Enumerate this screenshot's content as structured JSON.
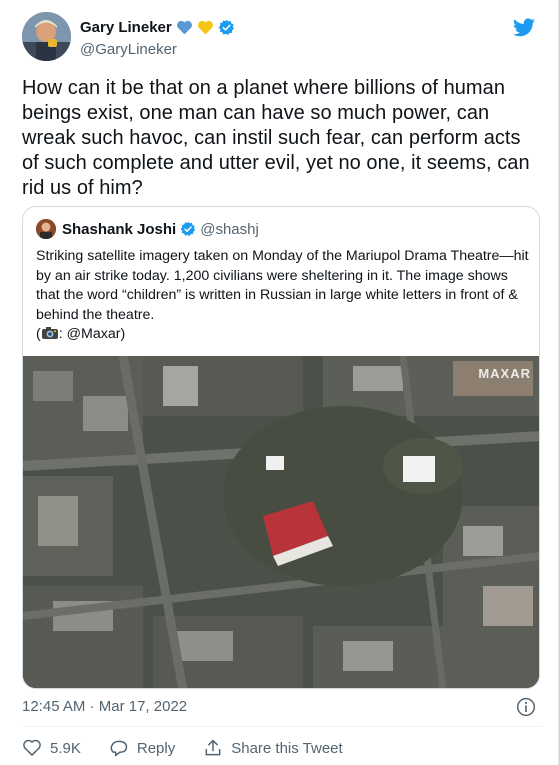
{
  "author": {
    "name": "Gary Lineker",
    "handle": "@GaryLineker"
  },
  "tweet": {
    "text": "How can it be that on a planet where billions of human beings exist, one man can have so much power, can wreak such havoc, can instil such fear, can perform acts of such complete and utter evil, yet no one, it seems, can rid us of him?"
  },
  "quoted": {
    "name": "Shashank Joshi",
    "handle": "@shashj",
    "text_line1": "Striking satellite imagery taken on Monday of the Mariupol Drama Theatre—hit by an air strike today. 1,200 civilians were sheltering in it. The image shows that the word “children” is written in Russian in large white letters in front of & behind the theatre.",
    "text_line2_prefix": "(",
    "text_line2_suffix": ": @Maxar)",
    "image_watermark": "MAXAR"
  },
  "meta": {
    "time": "12:45 AM",
    "separator": " · ",
    "date": "Mar 17, 2022"
  },
  "actions": {
    "likes": "5.9K",
    "reply": "Reply",
    "share": "Share this Tweet"
  },
  "colors": {
    "twitter_blue": "#1d9bf0",
    "heart_blue": "#5b9bd5",
    "heart_yellow": "#f5c518"
  }
}
